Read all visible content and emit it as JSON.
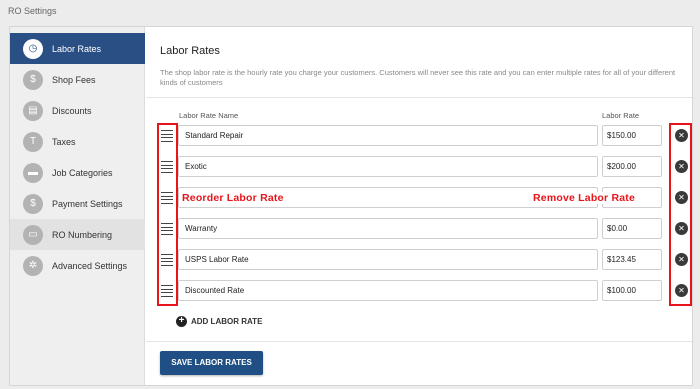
{
  "page_title": "RO Settings",
  "sidebar": {
    "items": [
      {
        "label": "Labor Rates",
        "icon": "stopwatch-icon",
        "glyph": "◷"
      },
      {
        "label": "Shop Fees",
        "icon": "dollar-tag-icon",
        "glyph": "$"
      },
      {
        "label": "Discounts",
        "icon": "store-icon",
        "glyph": "▤"
      },
      {
        "label": "Taxes",
        "icon": "tax-icon",
        "glyph": "T"
      },
      {
        "label": "Job Categories",
        "icon": "folder-icon",
        "glyph": "▬"
      },
      {
        "label": "Payment Settings",
        "icon": "dollar-circle-icon",
        "glyph": "$"
      },
      {
        "label": "RO Numbering",
        "icon": "car-icon",
        "glyph": "▭"
      },
      {
        "label": "Advanced Settings",
        "icon": "gear-icon",
        "glyph": "✲"
      }
    ]
  },
  "main": {
    "title": "Labor Rates",
    "description": "The shop labor rate is the hourly rate you charge your customers. Customers will never see this rate and you can enter multiple rates for all of your different kinds of customers",
    "col_name": "Labor Rate Name",
    "col_rate": "Labor Rate",
    "rows": [
      {
        "name": "Standard Repair",
        "rate": "$150.00"
      },
      {
        "name": "Exotic",
        "rate": "$200.00"
      },
      {
        "name": "",
        "rate": ""
      },
      {
        "name": "Warranty",
        "rate": "$0.00"
      },
      {
        "name": "USPS Labor Rate",
        "rate": "$123.45"
      },
      {
        "name": "Discounted Rate",
        "rate": "$100.00"
      }
    ],
    "annotation_reorder": "Reorder Labor Rate",
    "annotation_remove": "Remove Labor Rate",
    "add_label": "ADD LABOR RATE",
    "save_label": "SAVE LABOR RATES"
  },
  "colors": {
    "accent": "#2a4f84",
    "annotation": "#e8141a"
  }
}
